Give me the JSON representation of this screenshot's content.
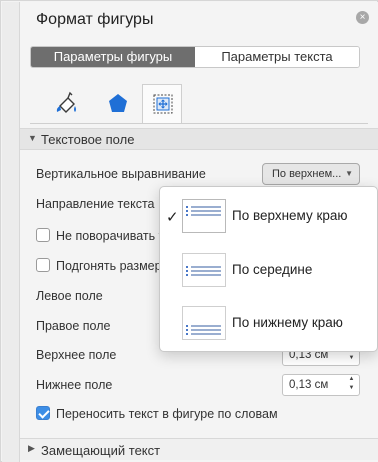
{
  "pane": {
    "title": "Формат фигуры",
    "close_label": "×"
  },
  "segments": {
    "shape_options": "Параметры фигуры",
    "text_options": "Параметры текста",
    "active": "shape_options"
  },
  "icon_tabs": [
    {
      "name": "fill-line-icon",
      "selected": false
    },
    {
      "name": "effects-pentagon-icon",
      "selected": false
    },
    {
      "name": "layout-properties-icon",
      "selected": true
    }
  ],
  "text_box_section": {
    "title": "Текстовое поле",
    "expanded": true,
    "vertical_alignment_label": "Вертикальное выравнивание",
    "vertical_alignment_value": "По верхнем...",
    "text_direction_label": "Направление текста",
    "do_not_rotate_label": "Не поворачивать т",
    "do_not_rotate_checked": false,
    "autofit_label": "Подгонять размер",
    "autofit_checked": false,
    "left_margin_label": "Левое поле",
    "right_margin_label": "Правое поле",
    "top_margin_label": "Верхнее поле",
    "top_margin_value": "0,13 см",
    "bottom_margin_label": "Нижнее поле",
    "bottom_margin_value": "0,13 см",
    "wrap_text_label": "Переносить текст в фигуре по словам",
    "wrap_text_checked": true
  },
  "alt_text_section": {
    "title": "Замещающий текст",
    "expanded": false
  },
  "dropdown": {
    "options": [
      {
        "label": "По верхнему краю",
        "selected": true,
        "icon": "align-top-icon"
      },
      {
        "label": "По середине",
        "selected": false,
        "icon": "align-middle-icon"
      },
      {
        "label": "По нижнему краю",
        "selected": false,
        "icon": "align-bottom-icon"
      }
    ],
    "check_glyph": "✓"
  },
  "colors": {
    "active_segment": "#6e6e6e",
    "checkbox_blue": "#3d8ee6",
    "pentagon_blue": "#1f6fd6"
  }
}
